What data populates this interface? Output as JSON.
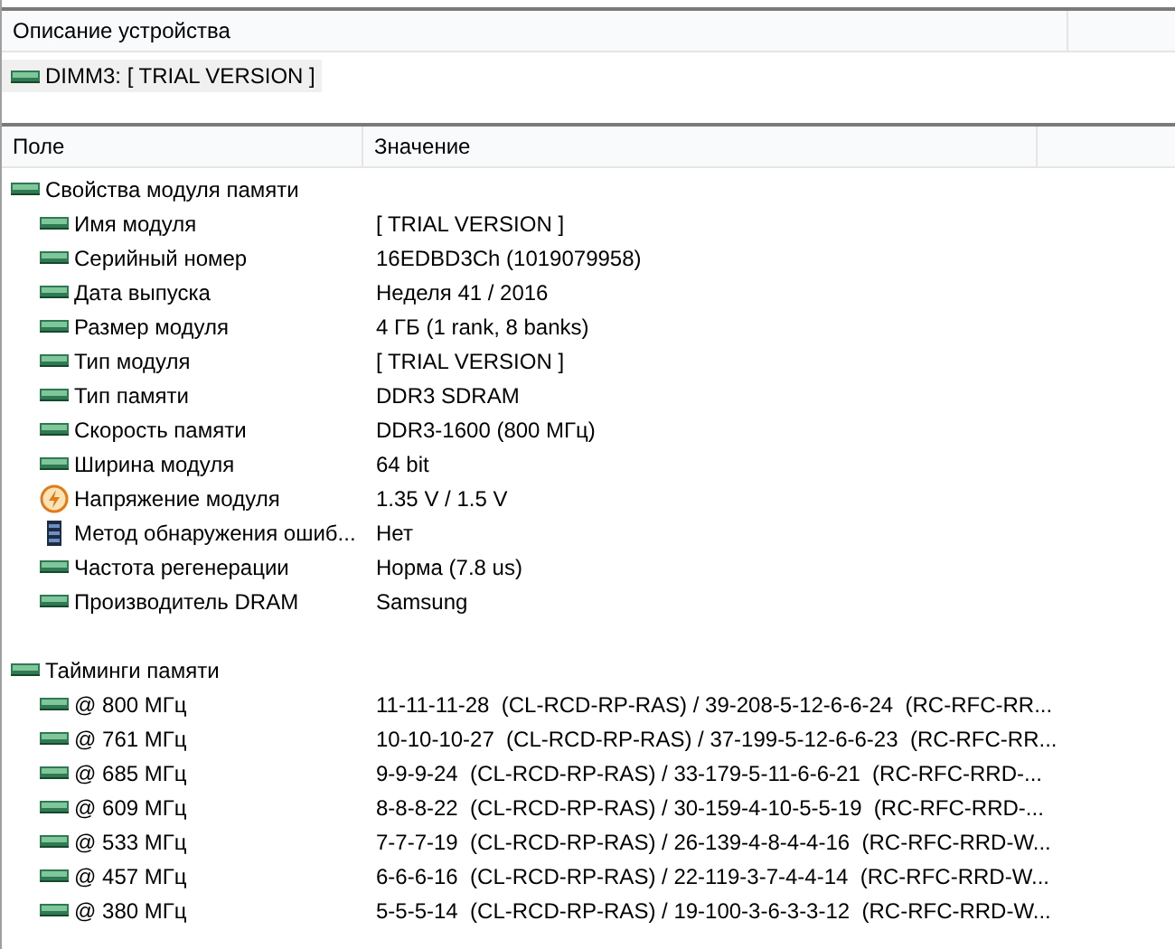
{
  "description_panel": {
    "header": "Описание устройства",
    "item": {
      "kind": "ram",
      "text": "DIMM3: [ TRIAL VERSION ]"
    }
  },
  "table": {
    "columns": [
      "Поле",
      "Значение"
    ],
    "groups": [
      {
        "kind": "ram",
        "field": "Свойства модуля памяти",
        "children": [
          {
            "kind": "ram",
            "field": "Имя модуля",
            "value": "[ TRIAL VERSION ]"
          },
          {
            "kind": "ram",
            "field": "Серийный номер",
            "value": "16EDBD3Ch (1019079958)"
          },
          {
            "kind": "ram",
            "field": "Дата выпуска",
            "value": "Неделя 41 / 2016"
          },
          {
            "kind": "ram",
            "field": "Размер модуля",
            "value": "4 ГБ (1 rank, 8 banks)"
          },
          {
            "kind": "ram",
            "field": "Тип модуля",
            "value": "[ TRIAL VERSION ]"
          },
          {
            "kind": "ram",
            "field": "Тип памяти",
            "value": "DDR3 SDRAM"
          },
          {
            "kind": "ram",
            "field": "Скорость памяти",
            "value": "DDR3-1600 (800 МГц)"
          },
          {
            "kind": "ram",
            "field": "Ширина модуля",
            "value": "64 bit"
          },
          {
            "kind": "power",
            "field": "Напряжение модуля",
            "value": "1.35 V / 1.5 V"
          },
          {
            "kind": "device",
            "field": "Метод обнаружения ошиб...",
            "value": "Нет"
          },
          {
            "kind": "ram",
            "field": "Частота регенерации",
            "value": "Норма (7.8 us)"
          },
          {
            "kind": "ram",
            "field": "Производитель DRAM",
            "value": "Samsung"
          }
        ]
      },
      {
        "kind": "ram",
        "field": "Тайминги памяти",
        "children": [
          {
            "kind": "ram",
            "field": "@ 800 МГц",
            "value": "11-11-11-28  (CL-RCD-RP-RAS) / 39-208-5-12-6-6-24  (RC-RFC-RR..."
          },
          {
            "kind": "ram",
            "field": "@ 761 МГц",
            "value": "10-10-10-27  (CL-RCD-RP-RAS) / 37-199-5-12-6-6-23  (RC-RFC-RR..."
          },
          {
            "kind": "ram",
            "field": "@ 685 МГц",
            "value": "9-9-9-24  (CL-RCD-RP-RAS) / 33-179-5-11-6-6-21  (RC-RFC-RRD-..."
          },
          {
            "kind": "ram",
            "field": "@ 609 МГц",
            "value": "8-8-8-22  (CL-RCD-RP-RAS) / 30-159-4-10-5-5-19  (RC-RFC-RRD-..."
          },
          {
            "kind": "ram",
            "field": "@ 533 МГц",
            "value": "7-7-7-19  (CL-RCD-RP-RAS) / 26-139-4-8-4-4-16  (RC-RFC-RRD-W..."
          },
          {
            "kind": "ram",
            "field": "@ 457 МГц",
            "value": "6-6-6-16  (CL-RCD-RP-RAS) / 22-119-3-7-4-4-14  (RC-RFC-RRD-W..."
          },
          {
            "kind": "ram",
            "field": "@ 380 МГц",
            "value": "5-5-5-14  (CL-RCD-RP-RAS) / 19-100-3-6-3-3-12  (RC-RFC-RRD-W..."
          }
        ]
      }
    ]
  }
}
